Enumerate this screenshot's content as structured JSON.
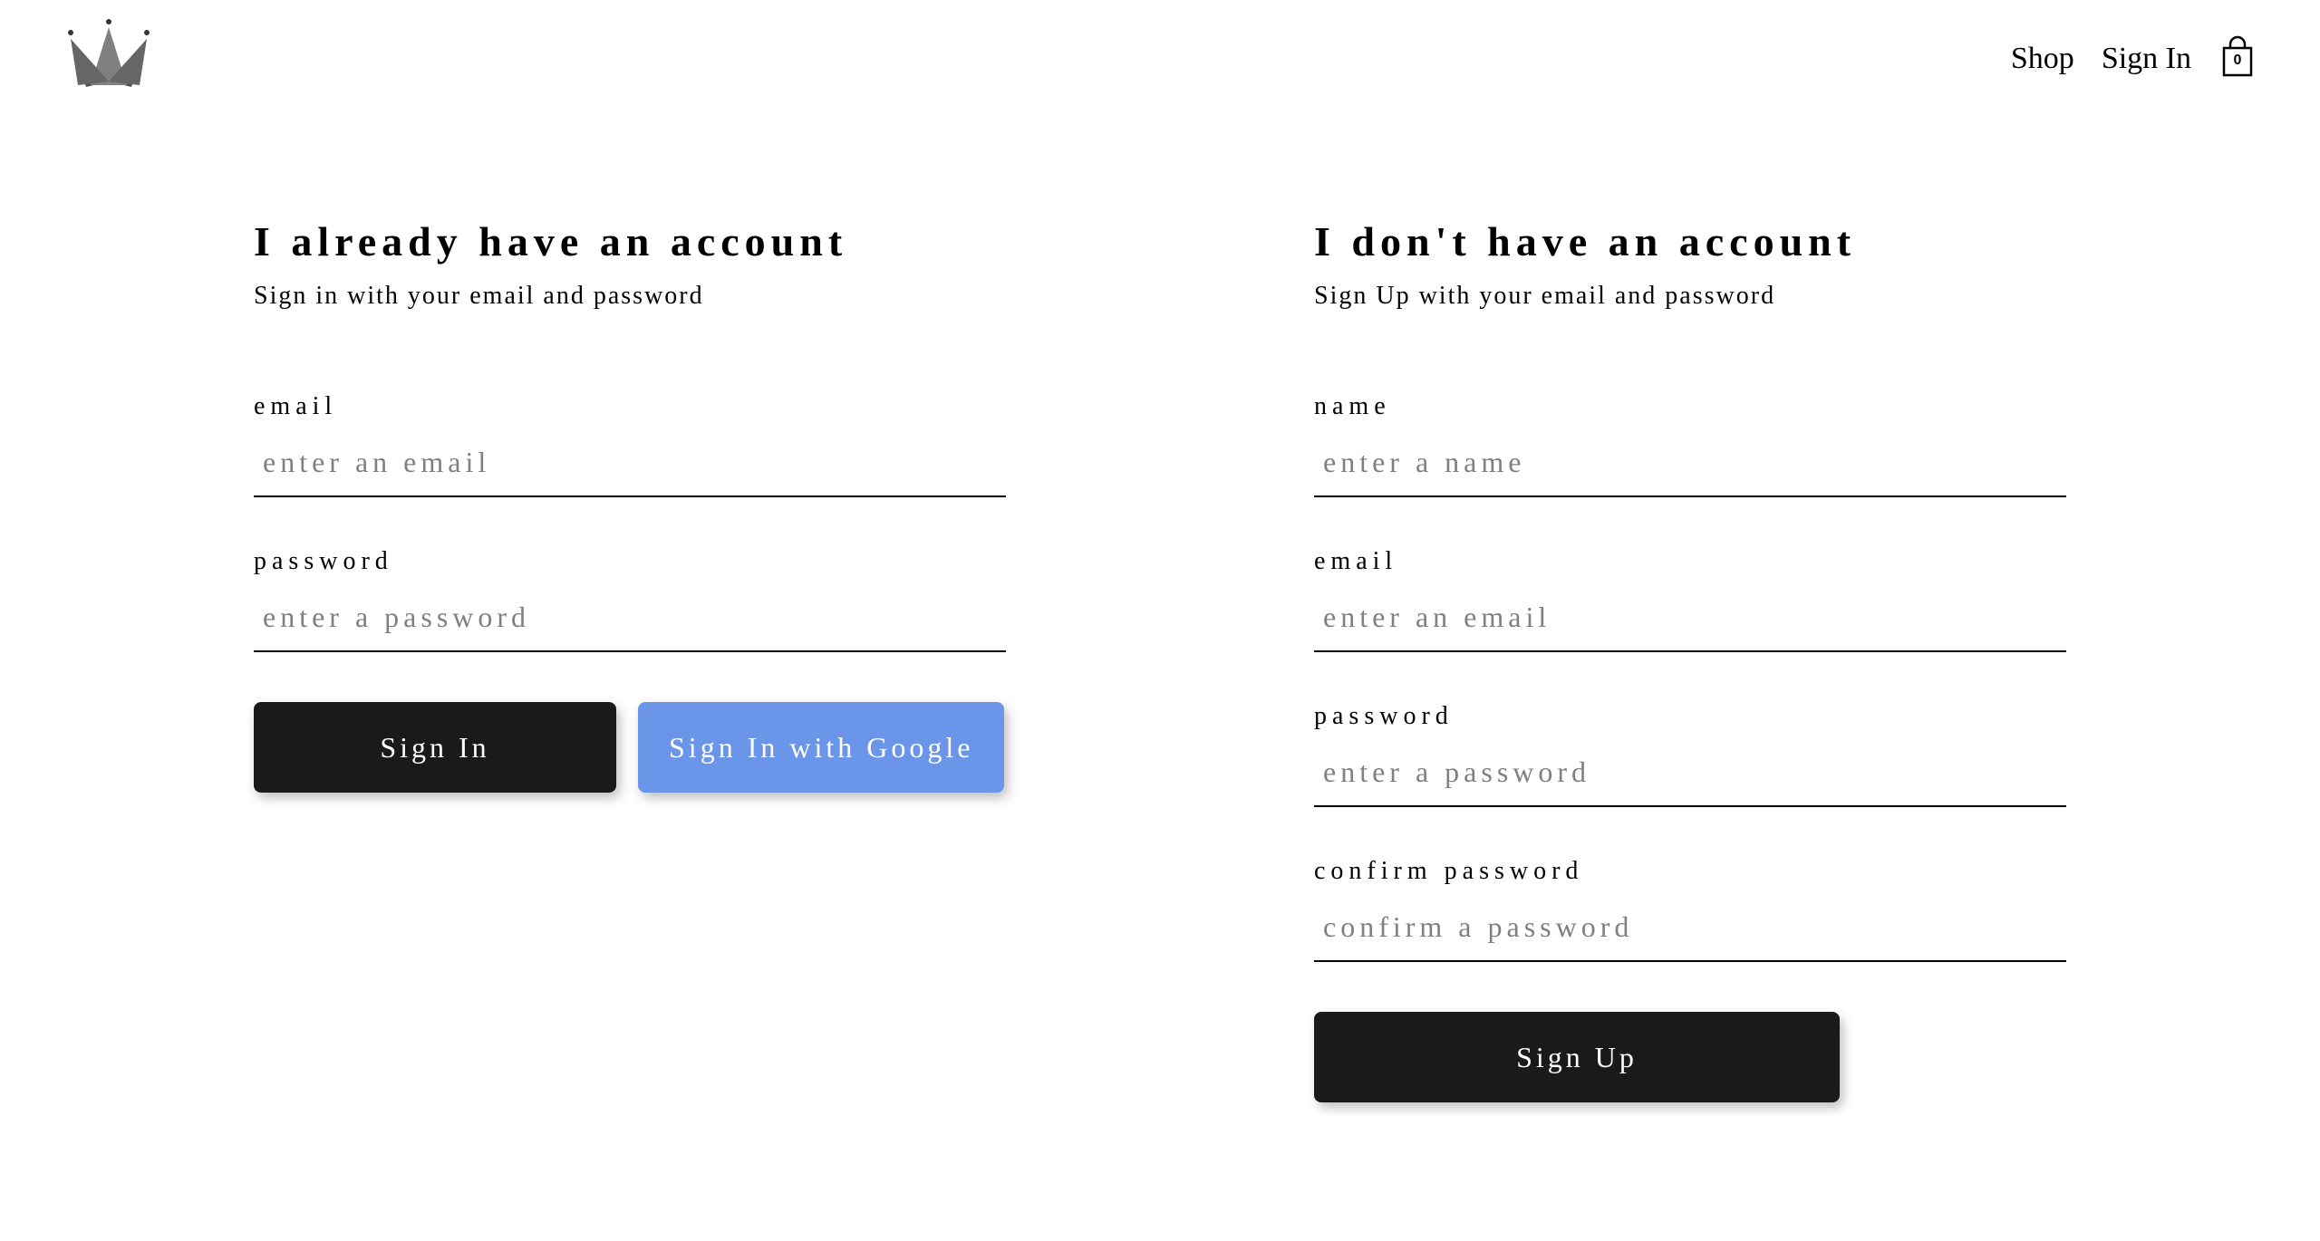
{
  "nav": {
    "shop": "Shop",
    "signin": "Sign In",
    "bag_count": "0"
  },
  "signin": {
    "title": "I already have an account",
    "sub": "Sign in with your email and password",
    "email_label": "email",
    "email_placeholder": "enter an email",
    "password_label": "password",
    "password_placeholder": "enter a password",
    "btn_signin": "Sign In",
    "btn_google": "Sign In with Google"
  },
  "signup": {
    "title": "I don't have an account",
    "sub": "Sign Up with your email and password",
    "name_label": "name",
    "name_placeholder": "enter a name",
    "email_label": "email",
    "email_placeholder": "enter an email",
    "password_label": "password",
    "password_placeholder": "enter a password",
    "confirm_label": "confirm password",
    "confirm_placeholder": "confirm a password",
    "btn_signup": "Sign Up"
  }
}
